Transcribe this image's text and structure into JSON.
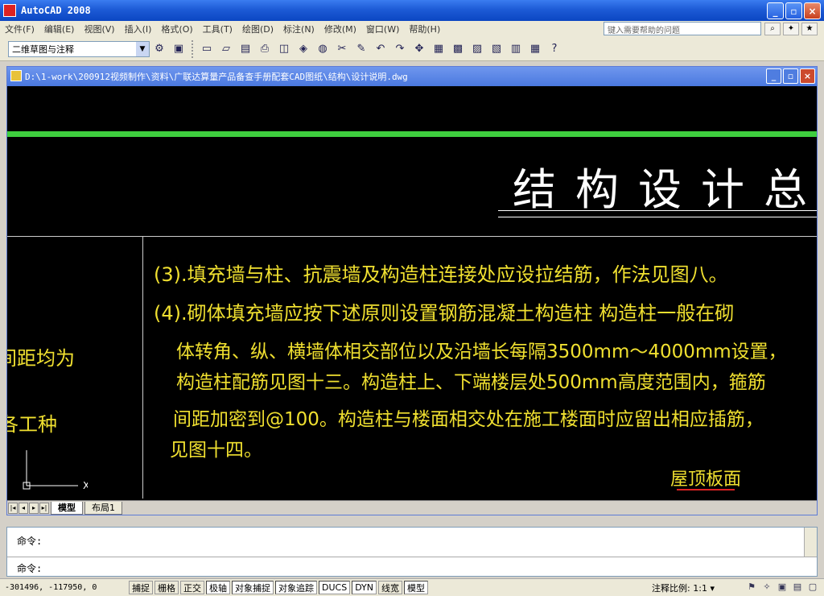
{
  "app": {
    "title": "AutoCAD 2008"
  },
  "window_buttons": [
    "_",
    "▫",
    "×"
  ],
  "menu": [
    "文件(F)",
    "编辑(E)",
    "视图(V)",
    "插入(I)",
    "格式(O)",
    "工具(T)",
    "绘图(D)",
    "标注(N)",
    "修改(M)",
    "窗口(W)",
    "帮助(H)"
  ],
  "help": {
    "placeholder": "键入需要帮助的问题"
  },
  "toolbar": {
    "workspace": "二维草图与注释"
  },
  "drawing": {
    "title": "D:\\1-work\\200912视频制作\\资料\\广联达算量产品备查手册配套CAD图纸\\结构\\设计说明.dwg",
    "heading": "结构设计总",
    "notes": [
      "(3).填充墙与柱、抗震墙及构造柱连接处应设拉结筋，作法见图八。",
      "(4).砌体填充墙应按下述原则设置钢筋混凝土构造柱  构造柱一般在砌",
      "体转角、纵、横墙体相交部位以及沿墙长每隔3500mm～4000mm设置，",
      "构造柱配筋见图十三。构造柱上、下端楼层处500mm高度范围内，箍筋",
      "间距加密到@100。构造柱与楼面相交处在施工楼面时应留出相应插筋，",
      "见图十四。"
    ],
    "left_notes": [
      "间距均为",
      "各工种"
    ],
    "roof_label": "屋顶板面",
    "tabs": [
      "模型",
      "布局1"
    ]
  },
  "command": {
    "line1": "命令:",
    "line2": "命令:"
  },
  "status": {
    "coords": "-301496, -117950, 0",
    "buttons": [
      "捕捉",
      "栅格",
      "正交",
      "极轴",
      "对象捕捉",
      "对象追踪",
      "DUCS",
      "DYN",
      "线宽",
      "模型"
    ],
    "scale_label": "注释比例:",
    "scale_value": "1:1"
  }
}
